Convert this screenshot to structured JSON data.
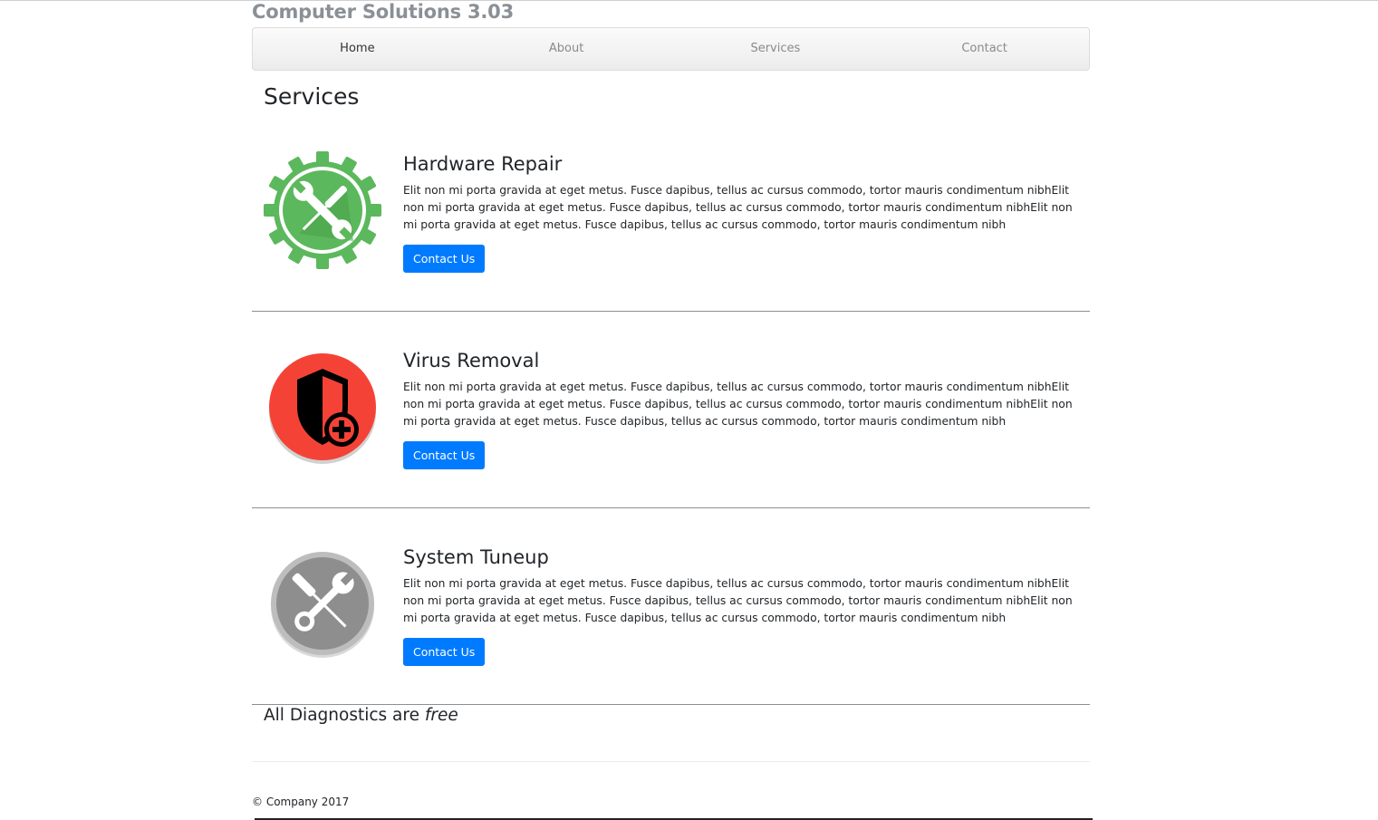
{
  "brand": {
    "title": "Computer Solutions 3.03"
  },
  "nav": {
    "items": [
      {
        "label": "Home",
        "active": true
      },
      {
        "label": "About",
        "active": false
      },
      {
        "label": "Services",
        "active": false
      },
      {
        "label": "Contact",
        "active": false
      }
    ]
  },
  "page": {
    "title": "Services"
  },
  "services": [
    {
      "title": "Hardware Repair",
      "description": "Elit non mi porta gravida at eget metus. Fusce dapibus, tellus ac cursus commodo, tortor mauris condimentum nibhElit non mi porta gravida at eget metus. Fusce dapibus, tellus ac cursus commodo, tortor mauris condimentum nibhElit non mi porta gravida at eget metus. Fusce dapibus, tellus ac cursus commodo, tortor mauris condimentum nibh",
      "button": "Contact Us",
      "icon": "gear-wrench-screwdriver-icon",
      "color": "#5cb85c"
    },
    {
      "title": "Virus Removal",
      "description": "Elit non mi porta gravida at eget metus. Fusce dapibus, tellus ac cursus commodo, tortor mauris condimentum nibhElit non mi porta gravida at eget metus. Fusce dapibus, tellus ac cursus commodo, tortor mauris condimentum nibhElit non mi porta gravida at eget metus. Fusce dapibus, tellus ac cursus commodo, tortor mauris condimentum nibh",
      "button": "Contact Us",
      "icon": "shield-plus-icon",
      "color": "#f44336"
    },
    {
      "title": "System Tuneup",
      "description": "Elit non mi porta gravida at eget metus. Fusce dapibus, tellus ac cursus commodo, tortor mauris condimentum nibhElit non mi porta gravida at eget metus. Fusce dapibus, tellus ac cursus commodo, tortor mauris condimentum nibhElit non mi porta gravida at eget metus. Fusce dapibus, tellus ac cursus commodo, tortor mauris condimentum nibh",
      "button": "Contact Us",
      "icon": "wrench-screwdriver-icon",
      "color": "#8e8e8e"
    }
  ],
  "diagnostics": {
    "prefix": "All Diagnostics are ",
    "emphasis": "free"
  },
  "footer": {
    "text": "© Company 2017"
  },
  "colors": {
    "accent": "#007bff",
    "brand_text": "#8a9096"
  }
}
